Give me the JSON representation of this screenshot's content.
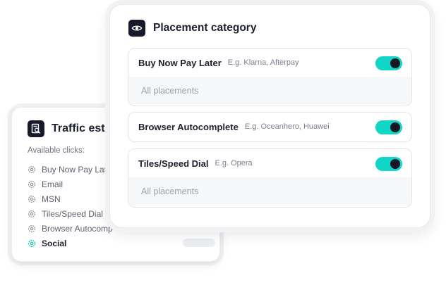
{
  "traffic_card": {
    "title": "Traffic est",
    "available_label": "Available clicks:",
    "items": [
      {
        "label": "Buy Now Pay Lat",
        "active": false
      },
      {
        "label": "Email",
        "active": false
      },
      {
        "label": "MSN",
        "active": false
      },
      {
        "label": "Tiles/Speed Dial",
        "active": false
      },
      {
        "label": "Browser Autocomp",
        "active": false
      },
      {
        "label": "Social",
        "active": true
      }
    ]
  },
  "placement_card": {
    "title": "Placement category",
    "categories": [
      {
        "name": "Buy Now Pay Later",
        "example": "E.g. Klarna, Afterpay",
        "enabled": true,
        "footer": "All placements"
      },
      {
        "name": "Browser Autocomplete",
        "example": "E.g. Oceanhero, Huawei",
        "enabled": true
      },
      {
        "name": "Tiles/Speed Dial",
        "example": "E.g. Opera",
        "enabled": true,
        "footer": "All placements"
      }
    ]
  },
  "colors": {
    "accent": "#10d6c6",
    "dark": "#161a2b",
    "active_item": "#10c9b9"
  },
  "icons": {
    "traffic": "search-document-icon",
    "placement": "eye-icon",
    "item": "gear-icon"
  }
}
